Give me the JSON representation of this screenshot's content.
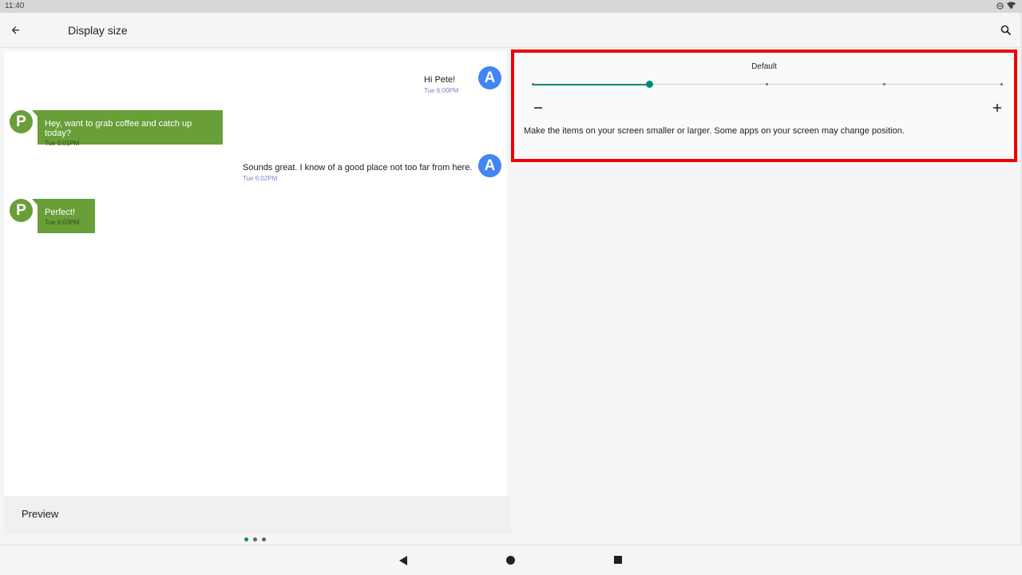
{
  "status_bar": {
    "time": "11:40",
    "icons": [
      "dnd-icon",
      "wifi-icon"
    ]
  },
  "app_bar": {
    "title": "Display size",
    "back_icon": "arrow-back-icon",
    "search_icon": "search-icon"
  },
  "preview": {
    "messages": [
      {
        "sender": "A",
        "text": "Hi Pete!",
        "time": "Tue 6:00PM",
        "direction": "outgoing"
      },
      {
        "sender": "P",
        "text": "Hey, want to grab coffee and catch up today?",
        "time": "Tue 6:01PM",
        "direction": "incoming"
      },
      {
        "sender": "A",
        "text": "Sounds great. I know of a good place not too far from here.",
        "time": "Tue 6:02PM",
        "direction": "outgoing"
      },
      {
        "sender": "P",
        "text": "Perfect!",
        "time": "Tue 6:03PM",
        "direction": "incoming"
      }
    ],
    "label": "Preview",
    "page_count": 3,
    "active_page": 0
  },
  "settings": {
    "current_size_label": "Default",
    "slider": {
      "steps": 5,
      "selected_index": 1
    },
    "minus_label": "−",
    "plus_label": "+",
    "description": "Make the items on your screen smaller or larger. Some apps on your screen may change position."
  },
  "colors": {
    "accent": "#00897b",
    "avatar_a": "#4285f4",
    "avatar_p": "#689f38",
    "highlight_border": "#ee0000"
  },
  "nav_bar": {
    "icons": [
      "nav-back-icon",
      "nav-home-icon",
      "nav-recents-icon"
    ]
  }
}
